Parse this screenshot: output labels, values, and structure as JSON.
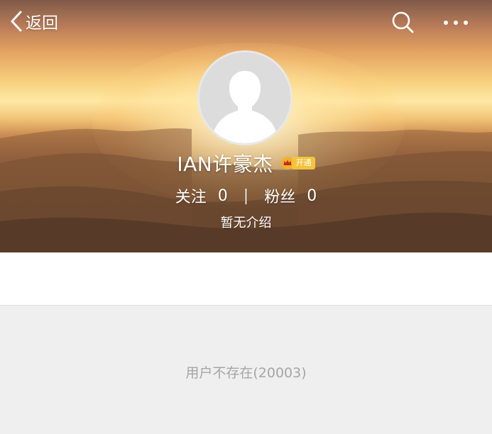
{
  "nav": {
    "back_label": "返回",
    "search_icon": "search-icon",
    "more_icon": "more-dots-icon"
  },
  "profile": {
    "username": "IAN许豪杰",
    "vip_badge": "开通",
    "following_label": "关注",
    "following_count": "0",
    "separator": "|",
    "followers_label": "粉丝",
    "followers_count": "0",
    "bio": "暂无介绍"
  },
  "main": {
    "error_message": "用户不存在(20003)"
  },
  "colors": {
    "header_text": "#ffffff",
    "badge_gold": "#f5c33b",
    "error_text": "#a5a5a5",
    "page_bg": "#efefef"
  }
}
